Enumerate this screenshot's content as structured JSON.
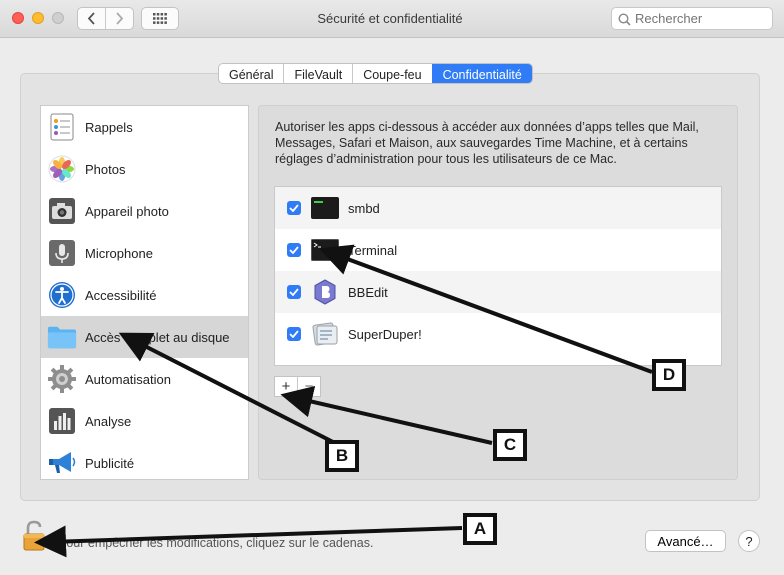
{
  "window": {
    "title": "Sécurité et confidentialité",
    "search_placeholder": "Rechercher",
    "back_icon": "chevron-left-icon",
    "forward_icon": "chevron-right-icon",
    "grid_icon": "grid-icon"
  },
  "tabs": [
    {
      "label": "Général",
      "active": false
    },
    {
      "label": "FileVault",
      "active": false
    },
    {
      "label": "Coupe-feu",
      "active": false
    },
    {
      "label": "Confidentialité",
      "active": true
    }
  ],
  "sidebar": {
    "items": [
      {
        "label": "Rappels",
        "icon": "reminders-icon",
        "selected": false
      },
      {
        "label": "Photos",
        "icon": "photos-icon",
        "selected": false
      },
      {
        "label": "Appareil photo",
        "icon": "camera-icon",
        "selected": false
      },
      {
        "label": "Microphone",
        "icon": "microphone-icon",
        "selected": false
      },
      {
        "label": "Accessibilité",
        "icon": "accessibility-icon",
        "selected": false
      },
      {
        "label": "Accès complet au disque",
        "icon": "folder-icon",
        "selected": true
      },
      {
        "label": "Automatisation",
        "icon": "gear-icon",
        "selected": false
      },
      {
        "label": "Analyse",
        "icon": "analytics-icon",
        "selected": false
      },
      {
        "label": "Publicité",
        "icon": "megaphone-icon",
        "selected": false
      }
    ]
  },
  "main": {
    "description": "Autoriser les apps ci-dessous à accéder aux données d’apps telles que Mail, Messages, Safari et Maison, aux sauvegardes Time Machine, et à certains réglages d’administration pour tous les utilisateurs de ce Mac.",
    "apps": [
      {
        "name": "smbd",
        "checked": true,
        "icon": "exec-icon"
      },
      {
        "name": "Terminal",
        "checked": true,
        "icon": "terminal-icon"
      },
      {
        "name": "BBEdit",
        "checked": true,
        "icon": "bbedit-icon"
      },
      {
        "name": "SuperDuper!",
        "checked": true,
        "icon": "superduper-icon"
      }
    ],
    "add_label": "+",
    "remove_label": "−"
  },
  "footer": {
    "lock_text": "Pour empêcher les modifications, cliquez sur le cadenas.",
    "advanced_label": "Avancé…",
    "help_label": "?"
  },
  "annotations": {
    "labels": [
      "A",
      "B",
      "C",
      "D"
    ],
    "color": "#111111"
  },
  "colors": {
    "accent": "#2f7cf6",
    "selection": "#d6d6d6"
  }
}
